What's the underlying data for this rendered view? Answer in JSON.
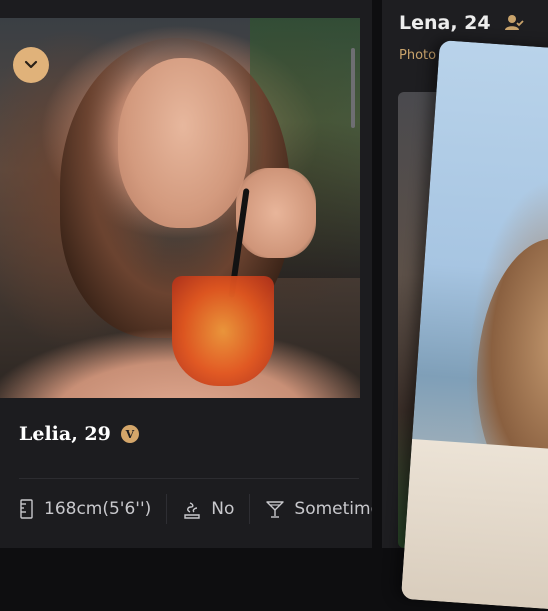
{
  "left_profile": {
    "name_age": "Lelia, 29",
    "verified_badge": "V",
    "attributes": [
      {
        "icon": "ruler-icon",
        "label": "168cm(5'6'')"
      },
      {
        "icon": "no-smoking-icon",
        "label": "No"
      },
      {
        "icon": "drink-glass-icon",
        "label": "Sometimes"
      }
    ]
  },
  "right_profile": {
    "name_age": "Lena, 24",
    "verification": "Photo Veri"
  },
  "colors": {
    "accent": "#d4a66a",
    "card_bg": "#1c1c1f",
    "text_primary": "#ffffff",
    "text_secondary": "#c8c8cc"
  }
}
